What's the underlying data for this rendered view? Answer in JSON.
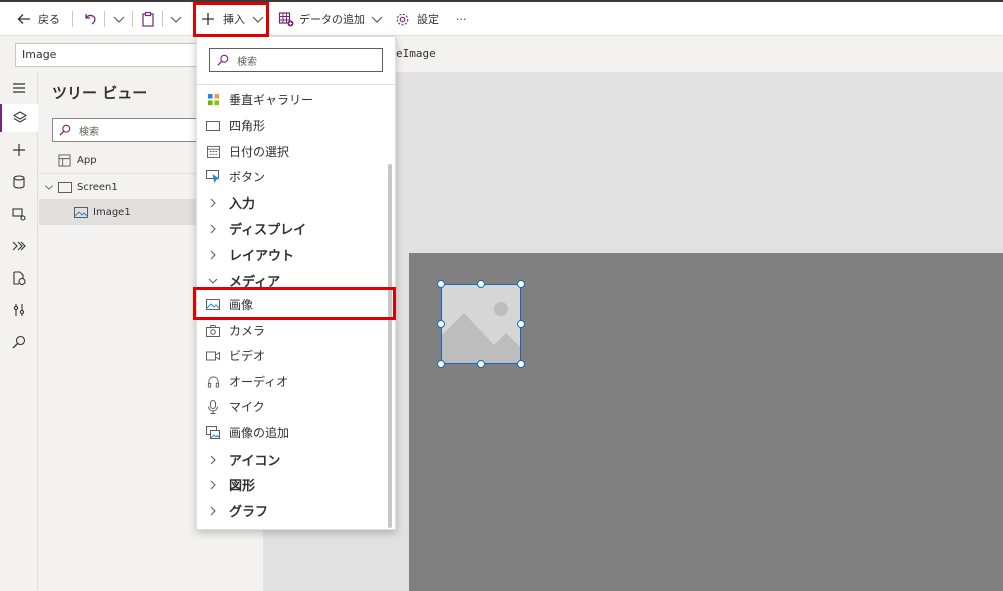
{
  "toolbar": {
    "back_label": "戻る",
    "insert_label": "挿入",
    "add_data_label": "データの追加",
    "settings_label": "設定",
    "more_label": "···"
  },
  "formula_bar": {
    "property": "Image",
    "formula": "eImage"
  },
  "tree_view": {
    "title": "ツリー ビュー",
    "search_placeholder": "検索",
    "app_label": "App",
    "screen_label": "Screen1",
    "image_label": "Image1"
  },
  "insert_menu": {
    "search_placeholder": "検索",
    "items": [
      {
        "label": "垂直ギャラリー",
        "icon": "gallery-icon",
        "kind": "item"
      },
      {
        "label": "四角形",
        "icon": "rectangle-icon",
        "kind": "item"
      },
      {
        "label": "日付の選択",
        "icon": "calendar-icon",
        "kind": "item"
      },
      {
        "label": "ボタン",
        "icon": "button-icon",
        "kind": "item"
      },
      {
        "label": "入力",
        "icon": "chevron-right-icon",
        "kind": "category"
      },
      {
        "label": "ディスプレイ",
        "icon": "chevron-right-icon",
        "kind": "category"
      },
      {
        "label": "レイアウト",
        "icon": "chevron-right-icon",
        "kind": "category"
      },
      {
        "label": "メディア",
        "icon": "chevron-down-icon",
        "kind": "category"
      },
      {
        "label": "画像",
        "icon": "image-icon",
        "kind": "item"
      },
      {
        "label": "カメラ",
        "icon": "camera-icon",
        "kind": "item"
      },
      {
        "label": "ビデオ",
        "icon": "video-icon",
        "kind": "item"
      },
      {
        "label": "オーディオ",
        "icon": "headphones-icon",
        "kind": "item"
      },
      {
        "label": "マイク",
        "icon": "microphone-icon",
        "kind": "item"
      },
      {
        "label": "画像の追加",
        "icon": "add-picture-icon",
        "kind": "item"
      },
      {
        "label": "アイコン",
        "icon": "chevron-right-icon",
        "kind": "category"
      },
      {
        "label": "図形",
        "icon": "chevron-right-icon",
        "kind": "category"
      },
      {
        "label": "グラフ",
        "icon": "chevron-right-icon",
        "kind": "category"
      }
    ]
  },
  "colors": {
    "accent": "#742774",
    "highlight": "#e00000",
    "selection": "#0f6cbd"
  }
}
